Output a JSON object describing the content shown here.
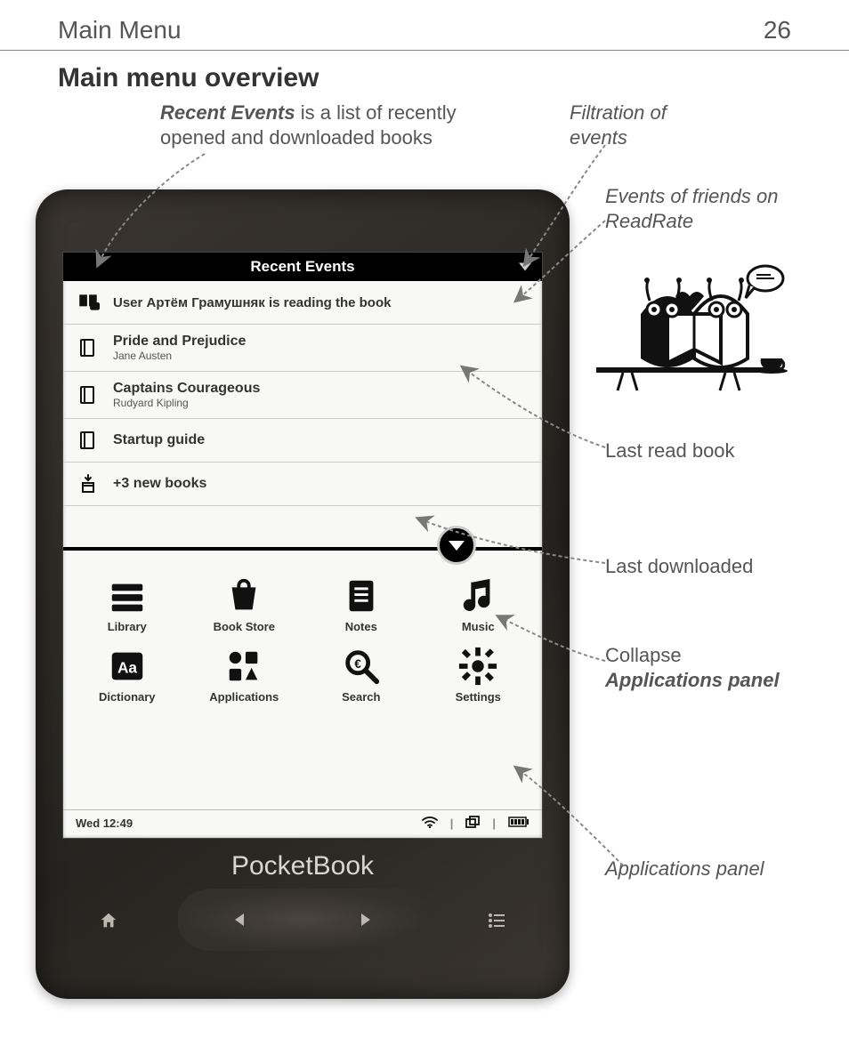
{
  "header": {
    "title": "Main Menu",
    "page_number": "26"
  },
  "section_title": "Main menu overview",
  "callouts": {
    "recent_events": {
      "bold": "Recent Events",
      "rest": " is a list of recently opened and downloaded books"
    },
    "filtration": "Filtration of events",
    "friends": "Events of friends on ReadRate",
    "last_read": "Last read book",
    "last_downloaded": "Last downloaded",
    "collapse_lead": "Collapse ",
    "collapse_bold": "Applications panel",
    "apps_panel": "Applications panel"
  },
  "screen": {
    "header": "Recent Events",
    "event_row": {
      "prefix": "User ",
      "user": "Артём Грамушняк",
      "suffix": " is reading the book"
    },
    "books": [
      {
        "title": "Pride and Prejudice",
        "author": "Jane Austen"
      },
      {
        "title": "Captains Courageous",
        "author": "Rudyard Kipling"
      },
      {
        "title": "Startup guide",
        "author": ""
      }
    ],
    "new_books": "+3 new books",
    "apps": [
      {
        "label": "Library",
        "icon": "library"
      },
      {
        "label": "Book Store",
        "icon": "store"
      },
      {
        "label": "Notes",
        "icon": "notes"
      },
      {
        "label": "Music",
        "icon": "music"
      },
      {
        "label": "Dictionary",
        "icon": "dictionary"
      },
      {
        "label": "Applications",
        "icon": "applications"
      },
      {
        "label": "Search",
        "icon": "search"
      },
      {
        "label": "Settings",
        "icon": "settings"
      }
    ],
    "status": {
      "time": "Wed 12:49"
    }
  },
  "brand": "PocketBook"
}
